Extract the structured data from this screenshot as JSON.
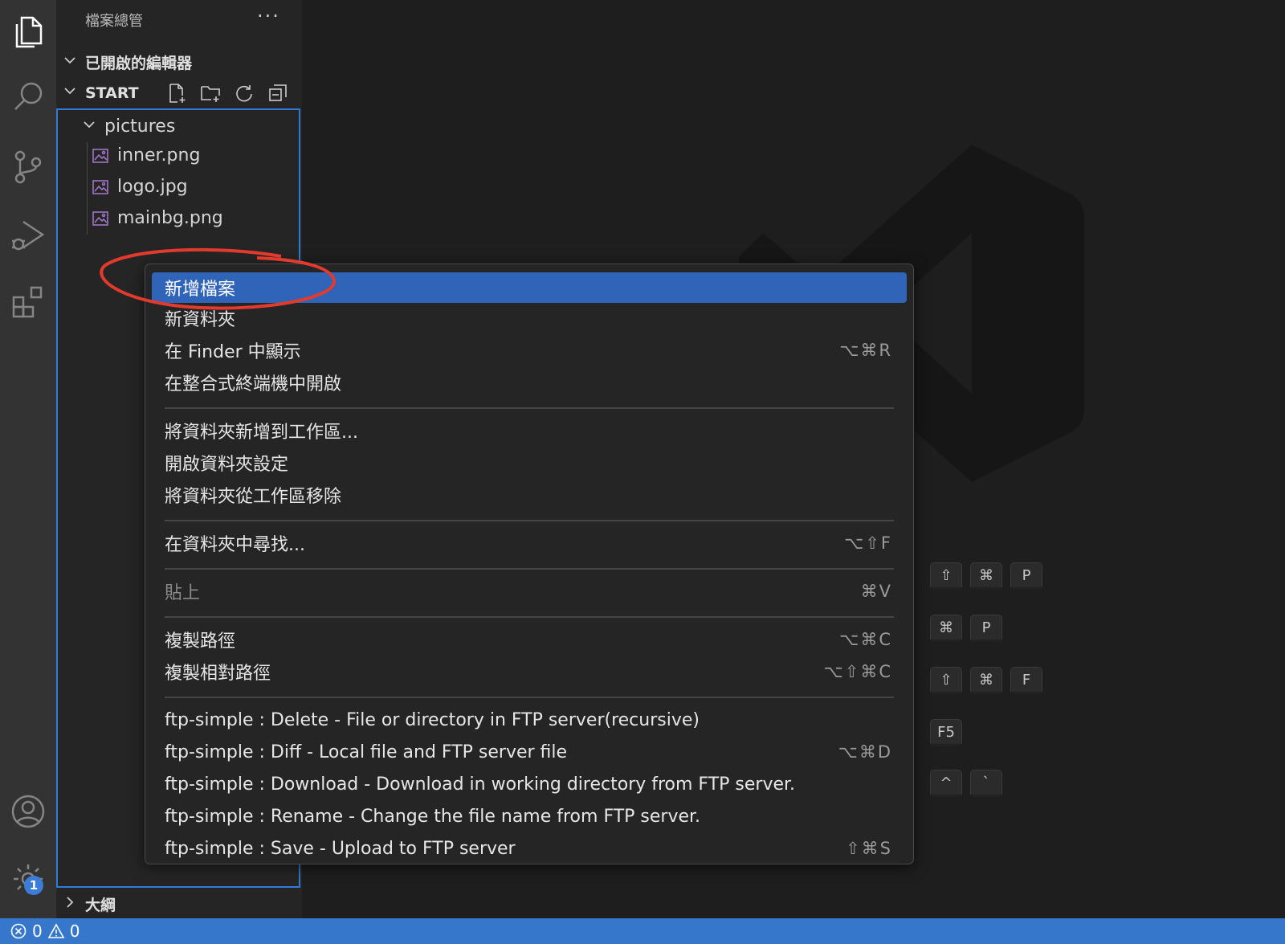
{
  "colors": {
    "accent": "#3677cc",
    "menu_highlight": "#2f64b8",
    "annotation": "#e23b2e"
  },
  "activity_bar": {
    "items": [
      {
        "name": "explorer-icon"
      },
      {
        "name": "search-icon"
      },
      {
        "name": "source-control-icon"
      },
      {
        "name": "run-debug-icon"
      },
      {
        "name": "extensions-icon"
      },
      {
        "name": "account-icon"
      },
      {
        "name": "settings-gear-icon"
      }
    ],
    "settings_badge": "1"
  },
  "sidebar": {
    "title": "檔案總管",
    "more": "···",
    "open_editors": "已開啟的編輯器",
    "workspace": "START",
    "toolbar": [
      "new-file-icon",
      "new-folder-icon",
      "refresh-icon",
      "collapse-all-icon"
    ],
    "folder": "pictures",
    "files": [
      "inner.png",
      "logo.jpg",
      "mainbg.png"
    ],
    "outline": "大綱"
  },
  "context_menu": {
    "items": [
      {
        "label": "新增檔案",
        "shortcut": "",
        "active": true
      },
      {
        "label": "新資料夾",
        "shortcut": ""
      },
      {
        "label": "在 Finder 中顯示",
        "shortcut": "⌥⌘R"
      },
      {
        "label": "在整合式終端機中開啟",
        "shortcut": ""
      },
      {
        "label": "將資料夾新增到工作區...",
        "shortcut": ""
      },
      {
        "label": "開啟資料夾設定",
        "shortcut": ""
      },
      {
        "label": "將資料夾從工作區移除",
        "shortcut": ""
      },
      {
        "label": "在資料夾中尋找...",
        "shortcut": "⌥⇧F"
      },
      {
        "label": "貼上",
        "shortcut": "⌘V",
        "disabled": true
      },
      {
        "label": "複製路徑",
        "shortcut": "⌥⌘C"
      },
      {
        "label": "複製相對路徑",
        "shortcut": "⌥⇧⌘C"
      },
      {
        "label": "ftp-simple : Delete - File or directory in FTP server(recursive)",
        "shortcut": ""
      },
      {
        "label": "ftp-simple : Diff - Local file and FTP server file",
        "shortcut": "⌥⌘D"
      },
      {
        "label": "ftp-simple : Download - Download in working directory from FTP server.",
        "shortcut": ""
      },
      {
        "label": "ftp-simple : Rename - Change the file name from FTP server.",
        "shortcut": ""
      },
      {
        "label": "ftp-simple : Save - Upload to FTP server",
        "shortcut": "⇧⌘S"
      }
    ]
  },
  "keyboard_hints": [
    [
      "⇧",
      "⌘",
      "P"
    ],
    [
      "⌘",
      "P"
    ],
    [
      "⇧",
      "⌘",
      "F"
    ],
    [
      "F5"
    ],
    [
      "^",
      "`"
    ]
  ],
  "status_bar": {
    "errors": "0",
    "warnings": "0"
  }
}
